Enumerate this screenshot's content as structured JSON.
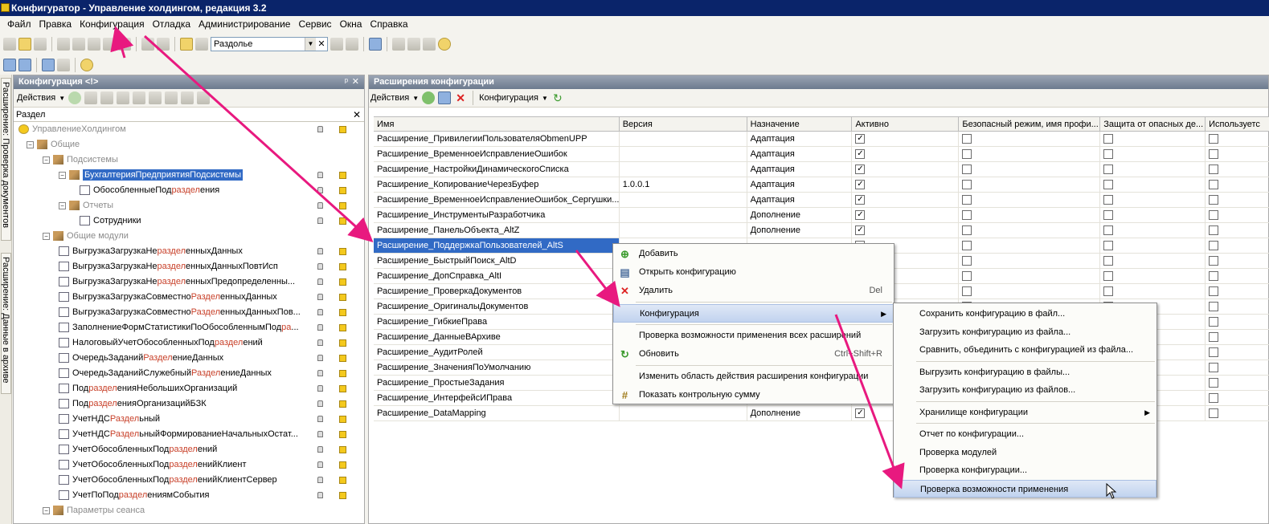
{
  "window": {
    "title": "Конфигуратор - Управление холдингом, редакция 3.2"
  },
  "menu": [
    "Файл",
    "Правка",
    "Конфигурация",
    "Отладка",
    "Администрирование",
    "Сервис",
    "Окна",
    "Справка"
  ],
  "toolbar": {
    "search_value": "Раздолье"
  },
  "left_tabs": [
    "Расширение: Проверка документов",
    "Расширение: Данные в архиве"
  ],
  "left_panel": {
    "title": "Конфигурация <!>",
    "actions_label": "Действия",
    "search_value": "Раздел",
    "tree": [
      {
        "pre": "УправлениеХолдингом",
        "hl": "",
        "post": "",
        "level": 0,
        "kind": "root",
        "gray": true
      },
      {
        "pre": "Общие",
        "hl": "",
        "post": "",
        "level": 1,
        "kind": "exp",
        "gray": true
      },
      {
        "pre": "Подсистемы",
        "hl": "",
        "post": "",
        "level": 2,
        "kind": "exp",
        "gray": true
      },
      {
        "pre": "БухгалтерияПредприятияПодсистемы",
        "hl": "",
        "post": "",
        "level": 3,
        "kind": "exp",
        "selected": true
      },
      {
        "pre": "ОбособленныеПод",
        "hl": "раздел",
        "post": "ения",
        "level": 4,
        "kind": "leaf"
      },
      {
        "pre": "Отчеты",
        "hl": "",
        "post": "",
        "level": 3,
        "kind": "exp",
        "gray": true
      },
      {
        "pre": "Сотрудники",
        "hl": "",
        "post": "",
        "level": 4,
        "kind": "leaf"
      },
      {
        "pre": "Общие модули",
        "hl": "",
        "post": "",
        "level": 2,
        "kind": "exp",
        "gray": true
      },
      {
        "pre": "ВыгрузкаЗагрузкаНе",
        "hl": "раздел",
        "post": "енныхДанных",
        "level": 3,
        "kind": "leaf"
      },
      {
        "pre": "ВыгрузкаЗагрузкаНе",
        "hl": "раздел",
        "post": "енныхДанныхПовтИсп",
        "level": 3,
        "kind": "leaf"
      },
      {
        "pre": "ВыгрузкаЗагрузкаНе",
        "hl": "раздел",
        "post": "енныхПредопределенны...",
        "level": 3,
        "kind": "leaf"
      },
      {
        "pre": "ВыгрузкаЗагрузкаСовместно",
        "hl": "Раздел",
        "post": "енныхДанных",
        "level": 3,
        "kind": "leaf"
      },
      {
        "pre": "ВыгрузкаЗагрузкаСовместно",
        "hl": "Раздел",
        "post": "енныхДанныхПов...",
        "level": 3,
        "kind": "leaf"
      },
      {
        "pre": "ЗаполнениеФормСтатистикиПоОбособленнымПод",
        "hl": "ра",
        "post": "...",
        "level": 3,
        "kind": "leaf"
      },
      {
        "pre": "НалоговыйУчетОбособленныхПод",
        "hl": "раздел",
        "post": "ений",
        "level": 3,
        "kind": "leaf"
      },
      {
        "pre": "ОчередьЗаданий",
        "hl": "Раздел",
        "post": "ениеДанных",
        "level": 3,
        "kind": "leaf"
      },
      {
        "pre": "ОчередьЗаданийСлужебный",
        "hl": "Раздел",
        "post": "ениеДанных",
        "level": 3,
        "kind": "leaf"
      },
      {
        "pre": "Под",
        "hl": "раздел",
        "post": "енияНебольшихОрганизаций",
        "level": 3,
        "kind": "leaf"
      },
      {
        "pre": "Под",
        "hl": "раздел",
        "post": "енияОрганизацийБЗК",
        "level": 3,
        "kind": "leaf"
      },
      {
        "pre": "УчетНДС",
        "hl": "Раздел",
        "post": "ьный",
        "level": 3,
        "kind": "leaf"
      },
      {
        "pre": "УчетНДС",
        "hl": "Раздел",
        "post": "ьныйФормированиеНачальныхОстат...",
        "level": 3,
        "kind": "leaf"
      },
      {
        "pre": "УчетОбособленныхПод",
        "hl": "раздел",
        "post": "ений",
        "level": 3,
        "kind": "leaf"
      },
      {
        "pre": "УчетОбособленныхПод",
        "hl": "раздел",
        "post": "енийКлиент",
        "level": 3,
        "kind": "leaf"
      },
      {
        "pre": "УчетОбособленныхПод",
        "hl": "раздел",
        "post": "енийКлиентСервер",
        "level": 3,
        "kind": "leaf"
      },
      {
        "pre": "УчетПоПод",
        "hl": "раздел",
        "post": "ениямСобытия",
        "level": 3,
        "kind": "leaf"
      },
      {
        "pre": "Параметры сеанса",
        "hl": "",
        "post": "",
        "level": 2,
        "kind": "exp",
        "gray": true
      }
    ]
  },
  "right_panel": {
    "title": "Расширения конфигурации",
    "actions_label": "Действия",
    "config_label": "Конфигурация",
    "columns": [
      "Имя",
      "Версия",
      "Назначение",
      "Активно",
      "Безопасный режим, имя профи...",
      "Защита от опасных де...",
      "Используетс"
    ],
    "rows": [
      {
        "name": "Расширение_ПривилегииПользователяObmenUPP",
        "version": "",
        "purpose": "Адаптация",
        "active": true
      },
      {
        "name": "Расширение_ВременноеИсправлениеОшибок",
        "version": "",
        "purpose": "Адаптация",
        "active": true
      },
      {
        "name": "Расширение_НастройкиДинамическогоСписка",
        "version": "",
        "purpose": "Адаптация",
        "active": true
      },
      {
        "name": "Расширение_КопированиеЧерезБуфер",
        "version": "1.0.0.1",
        "purpose": "Адаптация",
        "active": true
      },
      {
        "name": "Расширение_ВременноеИсправлениеОшибок_Сергушки...",
        "version": "",
        "purpose": "Адаптация",
        "active": true
      },
      {
        "name": "Расширение_ИнструментыРазработчика",
        "version": "",
        "purpose": "Дополнение",
        "active": true
      },
      {
        "name": "Расширение_ПанельОбъекта_AltZ",
        "version": "",
        "purpose": "Дополнение",
        "active": true
      },
      {
        "name": "Расширение_ПоддержкаПользователей_AltS",
        "version": "",
        "purpose": "",
        "active": false,
        "selected": true
      },
      {
        "name": "Расширение_БыстрыйПоиск_AltD",
        "version": "",
        "purpose": "",
        "active": false
      },
      {
        "name": "Расширение_ДопСправка_AltI",
        "version": "",
        "purpose": "",
        "active": false
      },
      {
        "name": "Расширение_ПроверкаДокументов",
        "version": "",
        "purpose": "",
        "active": false
      },
      {
        "name": "Расширение_ОригиналыДокументов",
        "version": "",
        "purpose": "",
        "active": false
      },
      {
        "name": "Расширение_ГибкиеПрава",
        "version": "",
        "purpose": "",
        "active": false
      },
      {
        "name": "Расширение_ДанныеВАрхиве",
        "version": "",
        "purpose": "",
        "active": false
      },
      {
        "name": "Расширение_АудитРолей",
        "version": "",
        "purpose": "",
        "active": false
      },
      {
        "name": "Расширение_ЗначенияПоУмолчанию",
        "version": "",
        "purpose": "",
        "active": false
      },
      {
        "name": "Расширение_ПростыеЗадания",
        "version": "",
        "purpose": "",
        "active": false
      },
      {
        "name": "Расширение_ИнтерфейсИПрава",
        "version": "",
        "purpose": "",
        "active": false
      },
      {
        "name": "Расширение_DataMapping",
        "version": "",
        "purpose": "Дополнение",
        "active": true
      }
    ]
  },
  "context_menu": {
    "items": [
      {
        "label": "Добавить",
        "shortcut": "",
        "icon": "add-icon"
      },
      {
        "label": "Открыть конфигурацию",
        "shortcut": "",
        "icon": "config-icon"
      },
      {
        "label": "Удалить",
        "shortcut": "Del",
        "icon": "delete-icon"
      },
      {
        "label": "Конфигурация",
        "shortcut": "",
        "icon": "",
        "submenu": true,
        "active": true
      },
      {
        "label": "Проверка возможности применения всех расширений",
        "shortcut": "",
        "icon": ""
      },
      {
        "label": "Обновить",
        "shortcut": "Ctrl+Shift+R",
        "icon": "refresh-icon"
      },
      {
        "label": "Изменить область действия расширения конфигурации",
        "shortcut": "",
        "icon": ""
      },
      {
        "label": "Показать контрольную сумму",
        "shortcut": "",
        "icon": "checksum-icon"
      }
    ]
  },
  "submenu": {
    "items": [
      {
        "label": "Сохранить конфигурацию в файл..."
      },
      {
        "label": "Загрузить конфигурацию из файла..."
      },
      {
        "label": "Сравнить, объединить с конфигурацией из файла..."
      },
      {
        "label": "Выгрузить конфигурацию в файлы..."
      },
      {
        "label": "Загрузить конфигурацию из файлов..."
      },
      {
        "label": "Хранилище конфигурации",
        "submenu": true
      },
      {
        "label": "Отчет по конфигурации..."
      },
      {
        "label": "Проверка модулей"
      },
      {
        "label": "Проверка конфигурации..."
      },
      {
        "label": "Проверка возможности применения",
        "active": true
      }
    ]
  },
  "colors": {
    "selection": "#316ac5",
    "arrow": "#e8197f",
    "highlight_text": "#c8412a"
  }
}
